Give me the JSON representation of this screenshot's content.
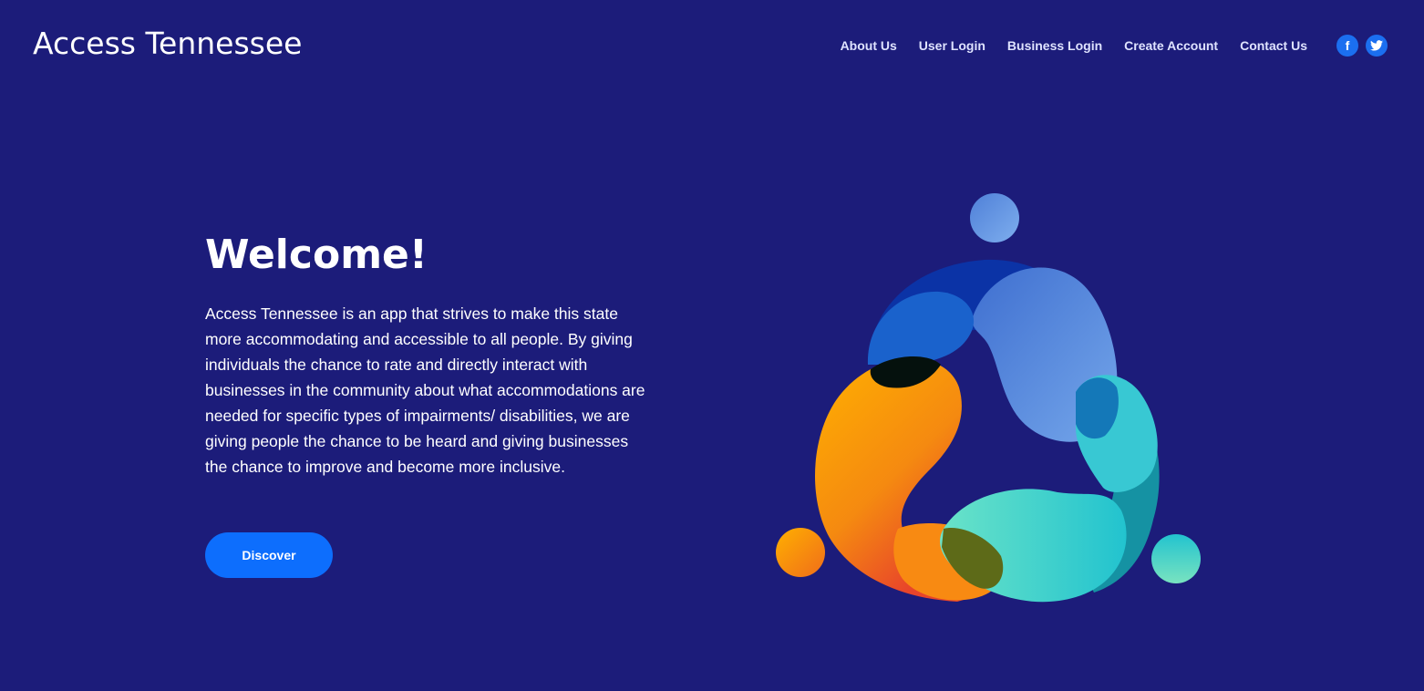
{
  "header": {
    "brand": "Access Tennessee",
    "nav": [
      "About Us",
      "User Login",
      "Business Login",
      "Create Account",
      "Contact Us"
    ],
    "social": [
      {
        "name": "facebook-icon",
        "glyph": "f"
      },
      {
        "name": "twitter-icon",
        "glyph": "t"
      }
    ]
  },
  "hero": {
    "title": "Welcome!",
    "body": "Access Tennessee is an app that strives to make this state more accommodating and accessible to all people. By giving individuals the chance to rate and directly interact with businesses in the community about what accommodations are needed for specific types of impairments/ disabilities, we are giving people the chance to be heard and giving businesses the chance to improve and become more inclusive.",
    "cta": "Discover"
  },
  "colors": {
    "background": "#1c1c7a",
    "accent": "#0d6efd",
    "blob_blue": "#6a9be6",
    "blob_orange": "#f6a400",
    "blob_teal": "#3fd1d0"
  }
}
